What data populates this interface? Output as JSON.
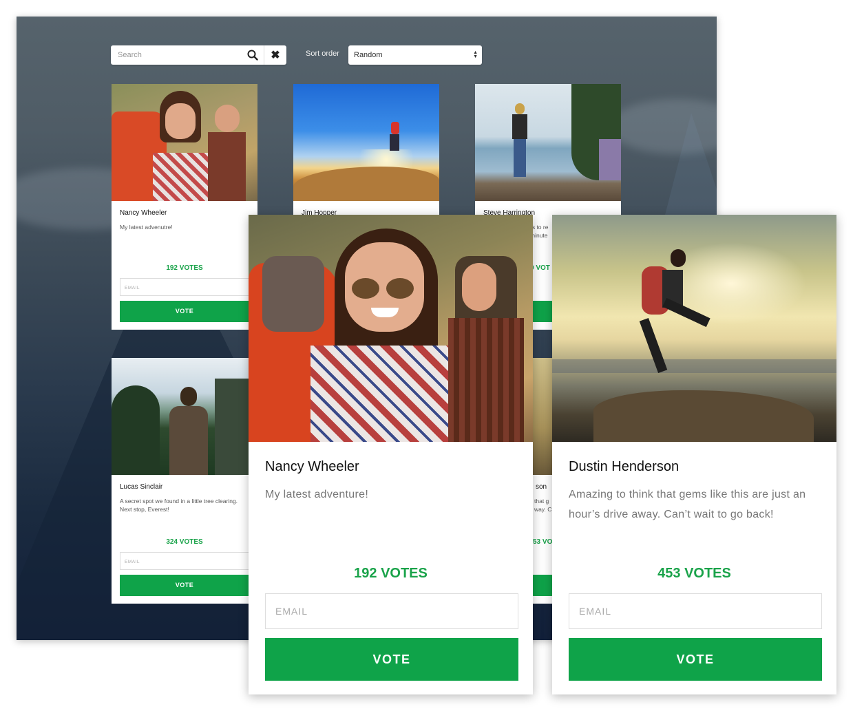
{
  "toolbar": {
    "search_placeholder": "Search",
    "search_icon": "search-icon",
    "clear_icon": "close-icon",
    "clear_glyph": "✖",
    "sort_label": "Sort order",
    "sort_value": "Random"
  },
  "grid_cards": [
    {
      "name": "Nancy Wheeler",
      "description": "My latest advenutre!",
      "votes": "192 VOTES",
      "email_placeholder": "EMAIL",
      "vote_label": "VOTE"
    },
    {
      "name": "Jim Hopper",
      "description": "",
      "votes": "",
      "email_placeholder": "",
      "vote_label": ""
    },
    {
      "name": "Steve Harrington",
      "description": "rs to re\nminute",
      "votes": "9 VOT",
      "email_placeholder": "",
      "vote_label": "VOT"
    },
    {
      "name": "Lucas Sinclair",
      "description": "A secret spot we found in a little tree clearing. Next stop, Everest!",
      "votes": "324 VOTES",
      "email_placeholder": "EMAIL",
      "vote_label": "VOTE"
    },
    {
      "name": "son",
      "description": "that g\nway. C",
      "votes": "53 VO",
      "email_placeholder": "",
      "vote_label": "VOT"
    }
  ],
  "featured_cards": [
    {
      "name": "Nancy Wheeler",
      "description": "My latest adventure!",
      "votes": "192 VOTES",
      "email_placeholder": "EMAIL",
      "vote_label": "VOTE"
    },
    {
      "name": "Dustin Henderson",
      "description": "Amazing to think that gems like this are just an hour’s drive away. Can’t wait to go back!",
      "votes": "453 VOTES",
      "email_placeholder": "EMAIL",
      "vote_label": "VOTE"
    }
  ],
  "colors": {
    "accent_green": "#0fa349",
    "votes_green": "#1aa34a"
  }
}
